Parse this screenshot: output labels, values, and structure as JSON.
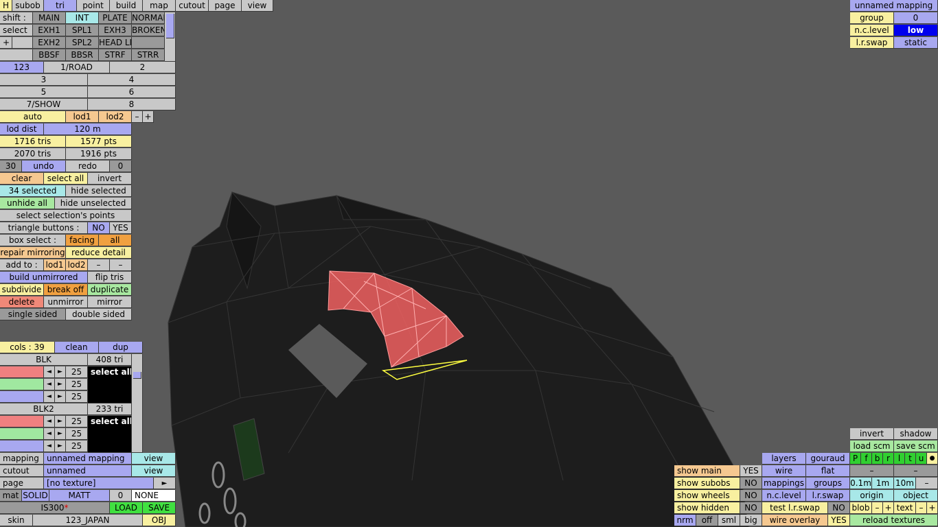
{
  "colors": {
    "background": "#5a5a5a",
    "mesh": "#1d1d1d",
    "wire": "#333333",
    "selected": "#f06060",
    "highlight": "#ffff40"
  },
  "menu": {
    "h": "H",
    "items": [
      "subob",
      "tri",
      "point",
      "build",
      "map",
      "cutout",
      "page",
      "view"
    ]
  },
  "subob": {
    "shift": "shift :",
    "select": "select",
    "plus": "+",
    "r1": [
      "MAIN",
      "INT",
      "PLATE",
      "NORMAL"
    ],
    "r2": [
      "EXH1",
      "SPL1",
      "EXH3",
      "BROKEN"
    ],
    "r3": [
      "EXH2",
      "SPL2",
      "HEAD LI",
      ""
    ],
    "r4": [
      "BBSF",
      "BBSR",
      "STRF",
      "STRR"
    ]
  },
  "lod_rows": {
    "r1": [
      "123",
      "1/ROAD",
      "2"
    ],
    "r2": [
      "3",
      "4"
    ],
    "r3": [
      "5",
      "6"
    ],
    "r4": [
      "7/SHOW",
      "8"
    ]
  },
  "tri": {
    "auto": "auto",
    "lod1": "lod1",
    "lod2": "lod2",
    "minus": "–",
    "plus": "+",
    "lod_dist": "lod dist",
    "lod_dist_val": "120 m",
    "tris1": "1716 tris",
    "pts1": "1577 pts",
    "tris2": "2070 tris",
    "pts2": "1916 pts",
    "undo_count": "30",
    "undo": "undo",
    "redo": "redo",
    "redo_count": "0",
    "clear": "clear",
    "select_all": "select all",
    "invert": "invert",
    "selected": "34 selected",
    "hide_selected": "hide selected",
    "unhide_all": "unhide all",
    "hide_unselected": "hide unselected",
    "select_points": "select selection's points",
    "tri_buttons": "triangle buttons :",
    "no": "NO",
    "yes": "YES",
    "box_select": "box select :",
    "facing": "facing",
    "all": "all",
    "repair": "repair mirroring",
    "reduce": "reduce detail",
    "add_to": "add to :",
    "add_lod1": "lod1",
    "add_lod2": "lod2",
    "add_m1": "–",
    "add_m2": "–",
    "build_unmirrored": "build unmirrored",
    "flip_tris": "flip tris",
    "subdivide": "subdivide",
    "break_off": "break off",
    "duplicate": "duplicate",
    "delete": "delete",
    "unmirror": "unmirror",
    "mirror": "mirror",
    "single_sided": "single sided",
    "double_sided": "double sided"
  },
  "cols": {
    "count": "cols : 39",
    "clean": "clean",
    "dup": "dup",
    "items": [
      {
        "name": "BLK",
        "tris": "408 tri",
        "vals": [
          "25",
          "25",
          "25"
        ],
        "select": "select all"
      },
      {
        "name": "BLK2",
        "tris": "233 tri",
        "vals": [
          "25",
          "25",
          "25"
        ],
        "select": "select all"
      }
    ],
    "arrow_l": "◄",
    "arrow_r": "►"
  },
  "props": {
    "mapping": "mapping",
    "mapping_val": "unnamed mapping",
    "view1": "view",
    "cutout": "cutout",
    "cutout_val": "unnamed",
    "view2": "view",
    "page": "page",
    "page_val": "[no texture]",
    "play": "►",
    "mat": "mat",
    "solid": "SOLID",
    "matt": "MATT",
    "zero": "0",
    "none": "NONE",
    "file": "IS300",
    "star": "*",
    "load": "LOAD",
    "save": "SAVE",
    "skin": "skin",
    "skin_val": "123_JAPAN",
    "obj": "OBJ"
  },
  "top_right": {
    "mapping": "unnamed mapping",
    "group": "group",
    "group_val": "0",
    "nclevel": "n.c.level",
    "nclevel_val": "low",
    "lrswap": "l.r.swap",
    "lrswap_val": "static"
  },
  "bottom_right": {
    "show_main": "show main",
    "show_main_v": "YES",
    "show_subobs": "show subobs",
    "show_subobs_v": "NO",
    "show_wheels": "show wheels",
    "show_wheels_v": "NO",
    "show_hidden": "show hidden",
    "show_hidden_v": "NO",
    "nrm": "nrm",
    "off": "off",
    "sml": "sml",
    "big": "big",
    "layers": "layers",
    "gouraud": "gouraud",
    "wire": "wire",
    "flat": "flat",
    "mappings": "mappings",
    "groups": "groups",
    "nclevel": "n.c.level",
    "lrswap": "l.r.swap",
    "test_lrswap": "test l.r.swap",
    "test_lrswap_v": "NO",
    "wire_overlay": "wire overlay",
    "wire_overlay_v": "YES",
    "invert": "invert",
    "shadow": "shadow",
    "load_scm": "load scm",
    "save_scm": "save scm",
    "letters": [
      "P",
      "f",
      "b",
      "r",
      "l",
      "t",
      "u"
    ],
    "dot": "●",
    "dash": "–",
    "d01": "0.1m",
    "d1": "1m",
    "d10": "10m",
    "dm": "–",
    "origin": "origin",
    "object": "object",
    "blob": "blob",
    "text": "text",
    "minus": "–",
    "plus": "+",
    "reload": "reload textures"
  }
}
